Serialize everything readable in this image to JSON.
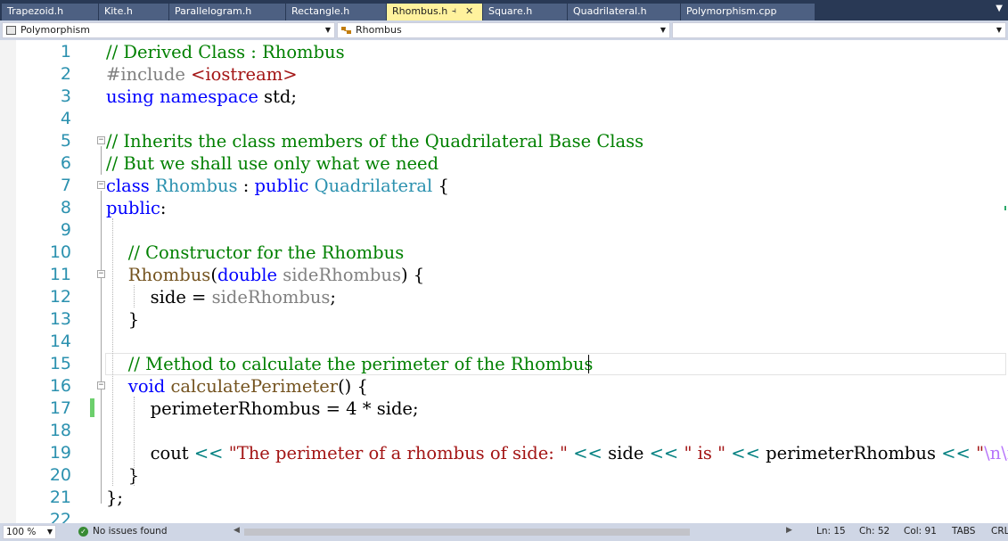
{
  "tabs": [
    {
      "label": "Trapezoid.h"
    },
    {
      "label": "Kite.h"
    },
    {
      "label": "Parallelogram.h"
    },
    {
      "label": "Rectangle.h"
    },
    {
      "label": "Rhombus.h",
      "active": true
    },
    {
      "label": "Square.h"
    },
    {
      "label": "Quadrilateral.h"
    },
    {
      "label": "Polymorphism.cpp"
    }
  ],
  "nav": {
    "project": "Polymorphism",
    "scope": "Rhombus",
    "member": ""
  },
  "lines": [
    {
      "n": "1",
      "tokens": [
        {
          "t": "// Derived Class : Rhombus",
          "c": "cm"
        }
      ]
    },
    {
      "n": "2",
      "tokens": [
        {
          "t": "#include ",
          "c": "pp"
        },
        {
          "t": "<iostream>",
          "c": "st"
        }
      ]
    },
    {
      "n": "3",
      "tokens": [
        {
          "t": "using",
          "c": "kw"
        },
        {
          "t": " ",
          "c": ""
        },
        {
          "t": "namespace",
          "c": "kw"
        },
        {
          "t": " std;",
          "c": ""
        }
      ]
    },
    {
      "n": "4",
      "tokens": []
    },
    {
      "n": "5",
      "tokens": [
        {
          "t": "// Inherits the class members of the Quadrilateral Base Class",
          "c": "cm"
        }
      ]
    },
    {
      "n": "6",
      "tokens": [
        {
          "t": "// But we shall use only what we need",
          "c": "cm"
        }
      ]
    },
    {
      "n": "7",
      "tokens": [
        {
          "t": "class",
          "c": "kw"
        },
        {
          "t": " ",
          "c": ""
        },
        {
          "t": "Rhombus",
          "c": "ty"
        },
        {
          "t": " : ",
          "c": ""
        },
        {
          "t": "public",
          "c": "kw"
        },
        {
          "t": " ",
          "c": ""
        },
        {
          "t": "Quadrilateral",
          "c": "ty"
        },
        {
          "t": " {",
          "c": ""
        }
      ]
    },
    {
      "n": "8",
      "tokens": [
        {
          "t": "public",
          "c": "kw"
        },
        {
          "t": ":",
          "c": ""
        }
      ]
    },
    {
      "n": "9",
      "tokens": []
    },
    {
      "n": "10",
      "tokens": [
        {
          "t": "    ",
          "c": ""
        },
        {
          "t": "// Constructor for the Rhombus",
          "c": "cm"
        }
      ]
    },
    {
      "n": "11",
      "tokens": [
        {
          "t": "    ",
          "c": ""
        },
        {
          "t": "Rhombus",
          "c": "fn"
        },
        {
          "t": "(",
          "c": ""
        },
        {
          "t": "double",
          "c": "kw"
        },
        {
          "t": " ",
          "c": ""
        },
        {
          "t": "sideRhombus",
          "c": "pr"
        },
        {
          "t": ") {",
          "c": ""
        }
      ]
    },
    {
      "n": "12",
      "tokens": [
        {
          "t": "        side = ",
          "c": ""
        },
        {
          "t": "sideRhombus",
          "c": "pr"
        },
        {
          "t": ";",
          "c": ""
        }
      ]
    },
    {
      "n": "13",
      "tokens": [
        {
          "t": "    }",
          "c": ""
        }
      ]
    },
    {
      "n": "14",
      "tokens": []
    },
    {
      "n": "15",
      "tokens": [
        {
          "t": "    ",
          "c": ""
        },
        {
          "t": "// Method to calculate the perimeter of the Rhombus",
          "c": "cm"
        }
      ]
    },
    {
      "n": "16",
      "tokens": [
        {
          "t": "    ",
          "c": ""
        },
        {
          "t": "void",
          "c": "kw"
        },
        {
          "t": " ",
          "c": ""
        },
        {
          "t": "calculatePerimeter",
          "c": "fn"
        },
        {
          "t": "() {",
          "c": ""
        }
      ]
    },
    {
      "n": "17",
      "tokens": [
        {
          "t": "        perimeterRhombus = 4 * side;",
          "c": ""
        }
      ]
    },
    {
      "n": "18",
      "tokens": []
    },
    {
      "n": "19",
      "tokens": [
        {
          "t": "        cout ",
          "c": ""
        },
        {
          "t": "<<",
          "c": "op"
        },
        {
          "t": " ",
          "c": ""
        },
        {
          "t": "\"The perimeter of a rhombus of side: \"",
          "c": "st"
        },
        {
          "t": " ",
          "c": ""
        },
        {
          "t": "<<",
          "c": "op"
        },
        {
          "t": " side ",
          "c": ""
        },
        {
          "t": "<<",
          "c": "op"
        },
        {
          "t": " ",
          "c": ""
        },
        {
          "t": "\" is \"",
          "c": "st"
        },
        {
          "t": " ",
          "c": ""
        },
        {
          "t": "<<",
          "c": "op"
        },
        {
          "t": " perimeterRhombus ",
          "c": ""
        },
        {
          "t": "<<",
          "c": "op"
        },
        {
          "t": " ",
          "c": ""
        },
        {
          "t": "\"",
          "c": "st"
        },
        {
          "t": "\\n\\n",
          "c": "es"
        },
        {
          "t": "\"",
          "c": "st"
        },
        {
          "t": ";",
          "c": ""
        }
      ]
    },
    {
      "n": "20",
      "tokens": [
        {
          "t": "    }",
          "c": ""
        }
      ]
    },
    {
      "n": "21",
      "tokens": [
        {
          "t": "};",
          "c": ""
        }
      ]
    },
    {
      "n": "22",
      "tokens": []
    }
  ],
  "status": {
    "zoom": "100 %",
    "issues": "No issues found",
    "ln": "Ln: 15",
    "ch": "Ch: 52",
    "col": "Col: 91",
    "tabs": "TABS",
    "eol": "CRLF"
  },
  "colors": {
    "keyword": "#0000ff",
    "comment": "#008000",
    "type": "#2b91af",
    "preprocessor": "#808080",
    "string": "#a31515",
    "operator": "#008080",
    "function": "#74531f",
    "escape": "#b776fb",
    "active_tab": "#fff29d"
  },
  "icons": {
    "pin": "pin-icon",
    "close": "close-icon",
    "overflow": "chevron-down-icon",
    "issues": "check-circle-icon"
  }
}
